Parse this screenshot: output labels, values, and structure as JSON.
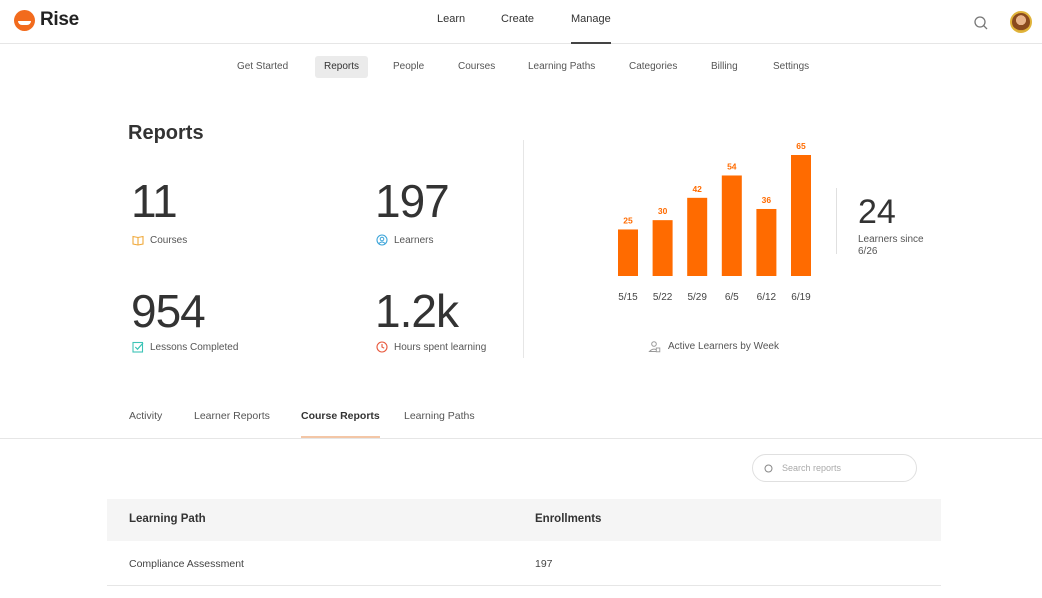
{
  "app": {
    "name": "Rise"
  },
  "header": {
    "nav": [
      {
        "label": "Learn"
      },
      {
        "label": "Create"
      },
      {
        "label": "Manage",
        "active": true
      }
    ]
  },
  "subnav": [
    {
      "label": "Get Started"
    },
    {
      "label": "Reports",
      "active": true
    },
    {
      "label": "People"
    },
    {
      "label": "Courses"
    },
    {
      "label": "Learning Paths"
    },
    {
      "label": "Categories"
    },
    {
      "label": "Billing"
    },
    {
      "label": "Settings"
    }
  ],
  "reports": {
    "title": "Reports",
    "stats": [
      {
        "value": "11",
        "label": "Courses",
        "icon": "book-icon",
        "color": "#f0a93b"
      },
      {
        "value": "197",
        "label": "Learners",
        "icon": "user-circle-icon",
        "color": "#3da5d9"
      },
      {
        "value": "954",
        "label": "Lessons Completed",
        "icon": "checkbox-icon",
        "color": "#3cc4b6"
      },
      {
        "value": "1.2k",
        "label": "Hours spent learning",
        "icon": "clock-icon",
        "color": "#e8573b"
      }
    ]
  },
  "chart_data": {
    "type": "bar",
    "categories": [
      "5/15",
      "5/22",
      "5/29",
      "6/5",
      "6/12",
      "6/19"
    ],
    "values": [
      25,
      30,
      42,
      54,
      36,
      65
    ],
    "ylim": [
      0,
      65
    ],
    "color": "#ff6b00",
    "caption": "Active Learners by Week",
    "summary": {
      "value": "24",
      "label": "Learners since 6/26"
    }
  },
  "tabs": [
    {
      "label": "Activity"
    },
    {
      "label": "Learner Reports"
    },
    {
      "label": "Course Reports",
      "active": true
    },
    {
      "label": "Learning Paths"
    }
  ],
  "search": {
    "placeholder": "Search reports"
  },
  "table": {
    "columns": [
      "Learning Path",
      "Enrollments"
    ],
    "rows": [
      [
        "Compliance Assessment",
        "197"
      ]
    ]
  }
}
